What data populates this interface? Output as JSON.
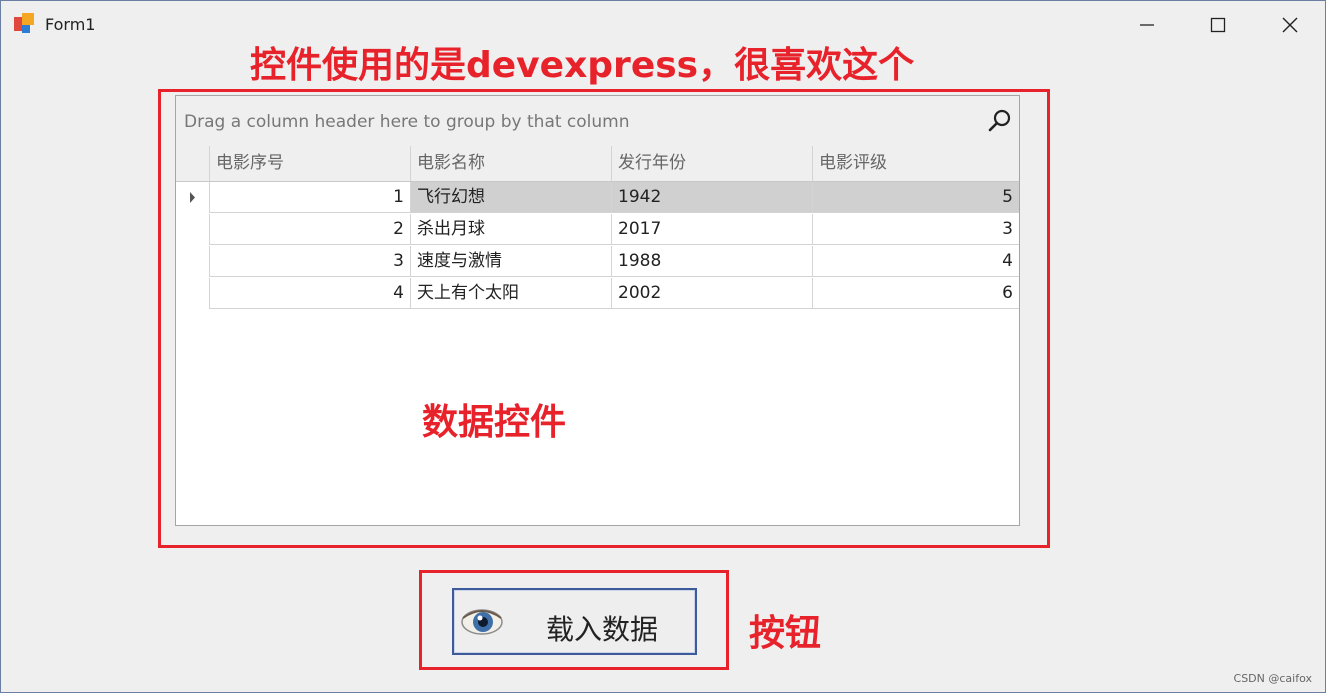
{
  "window": {
    "title": "Form1",
    "minimize_icon": "minimize-icon",
    "maximize_icon": "maximize-icon",
    "close_icon": "close-icon"
  },
  "annotations": {
    "top": "控件使用的是devexpress，很喜欢这个",
    "grid": "数据控件",
    "button": "按钮",
    "color": "#e8222a"
  },
  "grid": {
    "group_panel_text": "Drag a column header here to group by that column",
    "search_icon": "search-icon",
    "columns": [
      "电影序号",
      "电影名称",
      "发行年份",
      "电影评级"
    ],
    "rows": [
      {
        "id": "1",
        "name": "飞行幻想",
        "year": "1942",
        "rating": "5"
      },
      {
        "id": "2",
        "name": "杀出月球",
        "year": "2017",
        "rating": "3"
      },
      {
        "id": "3",
        "name": "速度与激情",
        "year": "1988",
        "rating": "4"
      },
      {
        "id": "4",
        "name": "天上有个太阳",
        "year": "2002",
        "rating": "6"
      }
    ],
    "selected_row_index": 0
  },
  "button": {
    "label": "载入数据",
    "icon": "eye-icon"
  },
  "watermark": "CSDN @caifox"
}
